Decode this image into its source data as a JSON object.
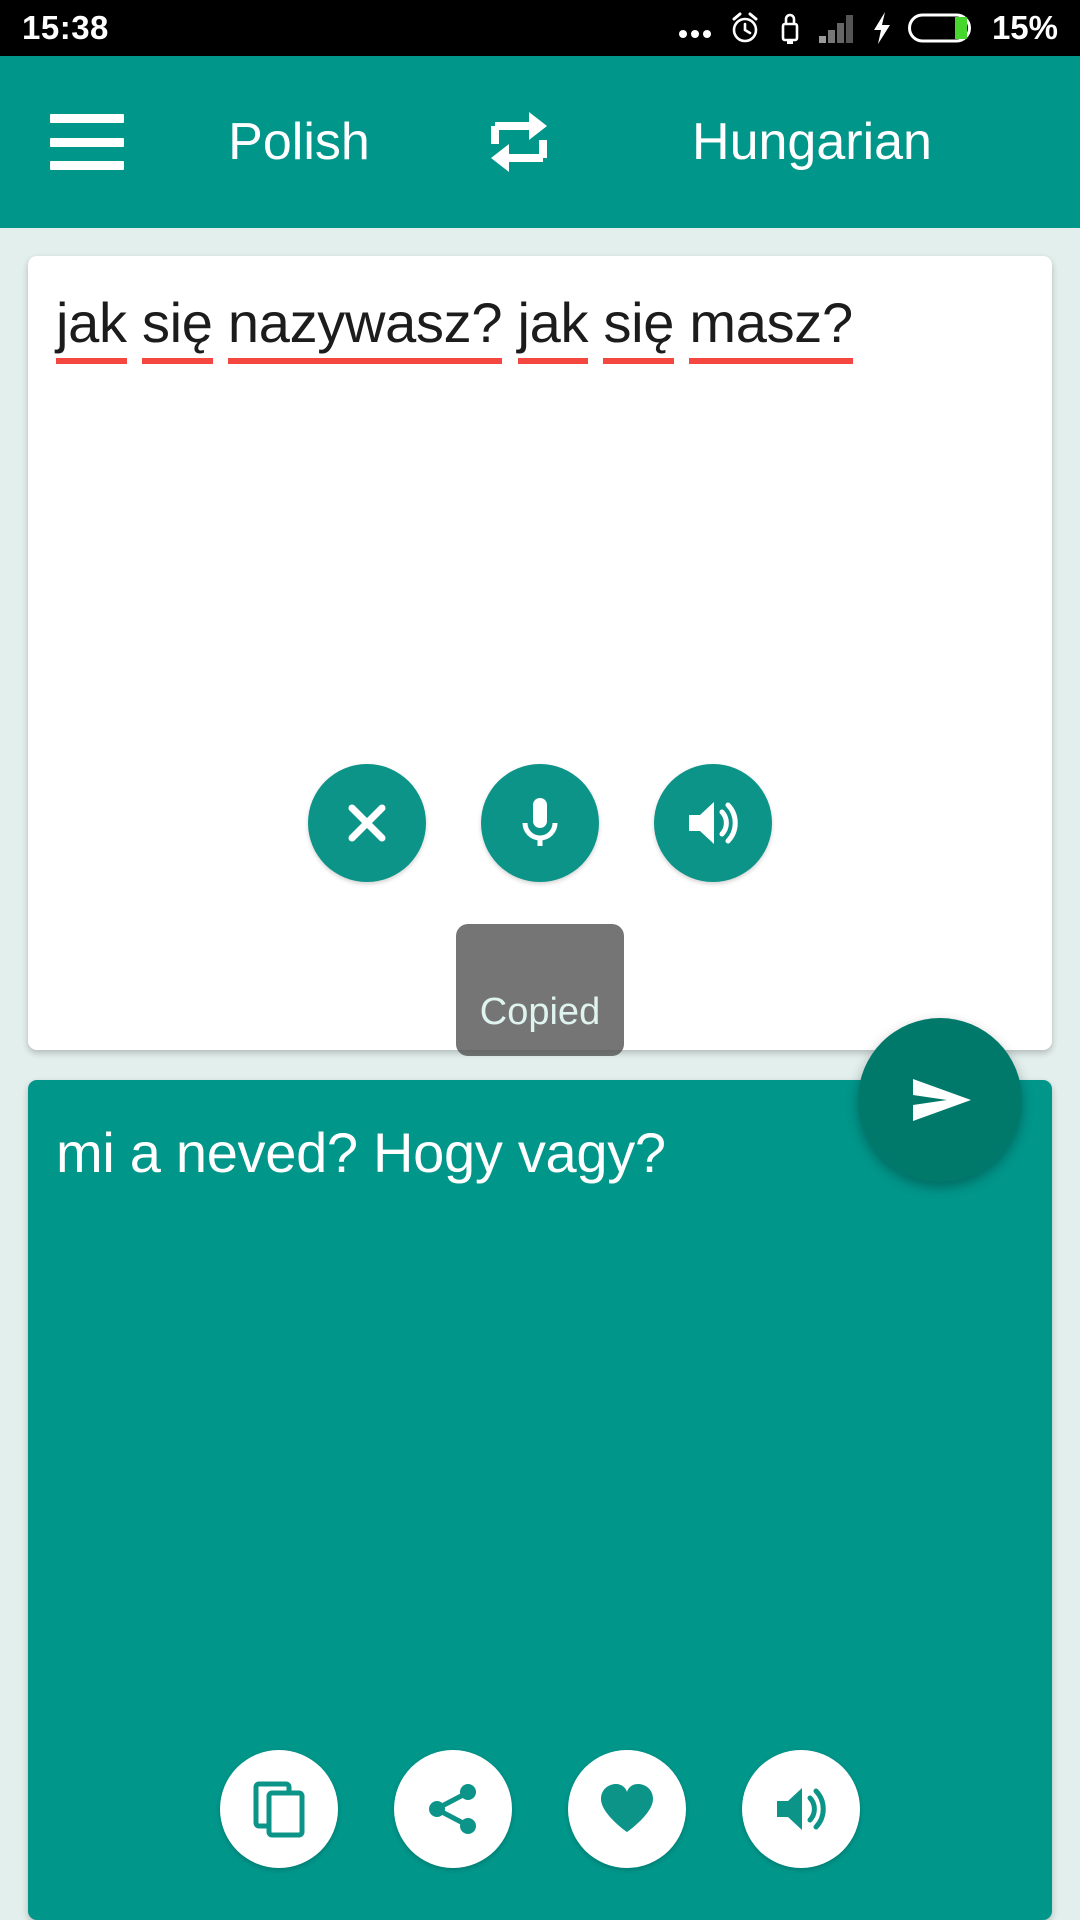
{
  "status_bar": {
    "time": "15:38",
    "battery_percent": "15%",
    "icons": [
      "more-dots-icon",
      "alarm-clock-icon",
      "usb-lock-icon",
      "signal-bars-icon",
      "charging-bolt-icon",
      "battery-icon"
    ]
  },
  "header": {
    "menu_icon": "hamburger-menu-icon",
    "source_language": "Polish",
    "swap_icon": "swap-languages-icon",
    "target_language": "Hungarian",
    "background_color": "#00968a"
  },
  "source_panel": {
    "text": "jak się nazywasz? jak się masz?",
    "words": [
      "jak",
      "się",
      "nazywasz?",
      "jak",
      "się",
      "masz?"
    ],
    "spellcheck_underline_color": "#f4473f",
    "actions": [
      {
        "name": "clear-button",
        "icon": "close-x-icon",
        "label": "Clear"
      },
      {
        "name": "microphone-button",
        "icon": "microphone-icon",
        "label": "Speak"
      },
      {
        "name": "speak-source-button",
        "icon": "speaker-volume-icon",
        "label": "Listen"
      }
    ]
  },
  "toast": {
    "message": "Copied"
  },
  "translate_fab": {
    "icon": "send-arrow-icon",
    "label": "Translate",
    "color": "#00796b"
  },
  "target_panel": {
    "text": "mi a neved? Hogy vagy?",
    "background_color": "#00968a",
    "actions": [
      {
        "name": "copy-button",
        "icon": "copy-icon",
        "label": "Copy"
      },
      {
        "name": "share-button",
        "icon": "share-icon",
        "label": "Share"
      },
      {
        "name": "favorite-button",
        "icon": "heart-icon",
        "label": "Favorite"
      },
      {
        "name": "speak-target-button",
        "icon": "speaker-volume-icon",
        "label": "Listen"
      }
    ]
  },
  "theme": {
    "page_background": "#e3efed",
    "accent": "#0d9488"
  }
}
